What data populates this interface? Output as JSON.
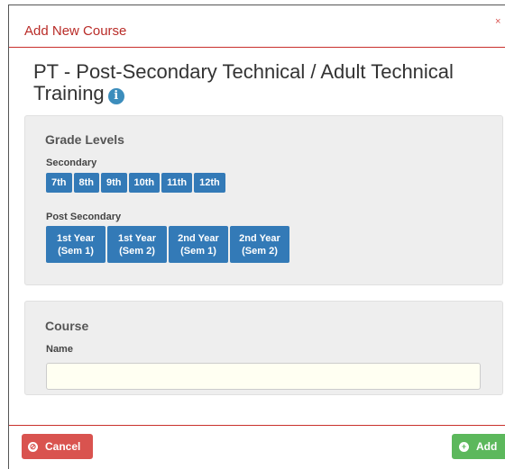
{
  "modal": {
    "title": "Add New Course",
    "close_symbol": "×"
  },
  "course": {
    "heading": "PT - Post-Secondary Technical / Adult Technical Training",
    "info_icon": "i"
  },
  "grade_levels": {
    "title": "Grade Levels",
    "secondary": {
      "label": "Secondary",
      "buttons": [
        "7th",
        "8th",
        "9th",
        "10th",
        "11th",
        "12th"
      ]
    },
    "post_secondary": {
      "label": "Post Secondary",
      "buttons": [
        {
          "line1": "1st Year",
          "line2": "(Sem 1)"
        },
        {
          "line1": "1st Year",
          "line2": "(Sem 2)"
        },
        {
          "line1": "2nd Year",
          "line2": "(Sem 1)"
        },
        {
          "line1": "2nd Year",
          "line2": "(Sem 2)"
        }
      ]
    }
  },
  "course_panel": {
    "title": "Course",
    "name_label": "Name",
    "name_value": ""
  },
  "footer": {
    "cancel_label": "Cancel",
    "cancel_icon": "cancel-circle-icon",
    "add_label": "Add",
    "add_icon": "plus-circle-icon"
  },
  "colors": {
    "header_accent": "#b92c28",
    "primary_button": "#337ab7",
    "danger_button": "#d9534f",
    "success_button": "#5cb85c",
    "info_icon": "#3c8dbc"
  }
}
